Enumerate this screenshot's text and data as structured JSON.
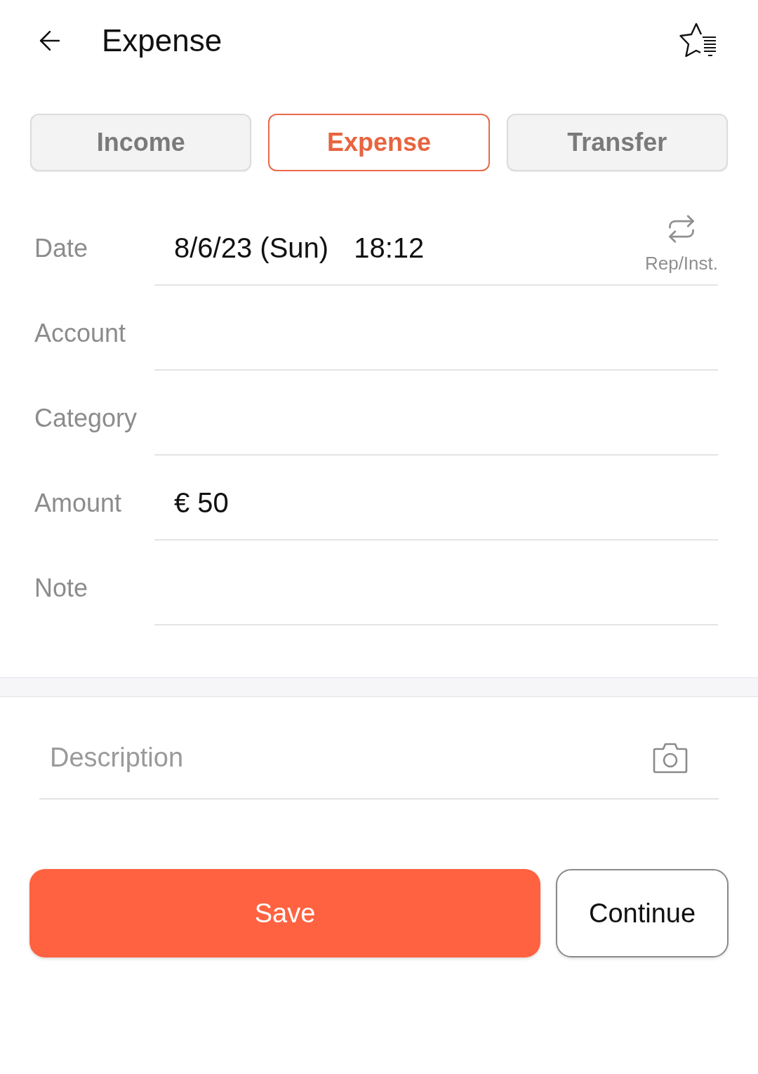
{
  "header": {
    "title": "Expense"
  },
  "tabs": [
    {
      "label": "Income",
      "selected": false
    },
    {
      "label": "Expense",
      "selected": true
    },
    {
      "label": "Transfer",
      "selected": false
    }
  ],
  "date_row": {
    "label": "Date",
    "date": "8/6/23 (Sun)",
    "time": "18:12",
    "repeat_label": "Rep/Inst."
  },
  "fields": [
    {
      "label": "Account"
    },
    {
      "label": "Category"
    },
    {
      "label": "Amount",
      "value": "€ 50"
    },
    {
      "label": "Note"
    }
  ],
  "description": {
    "placeholder": "Description"
  },
  "buttons": [
    {
      "label": "Save",
      "kind": "primary"
    },
    {
      "label": "Continue",
      "kind": "secondary"
    }
  ]
}
